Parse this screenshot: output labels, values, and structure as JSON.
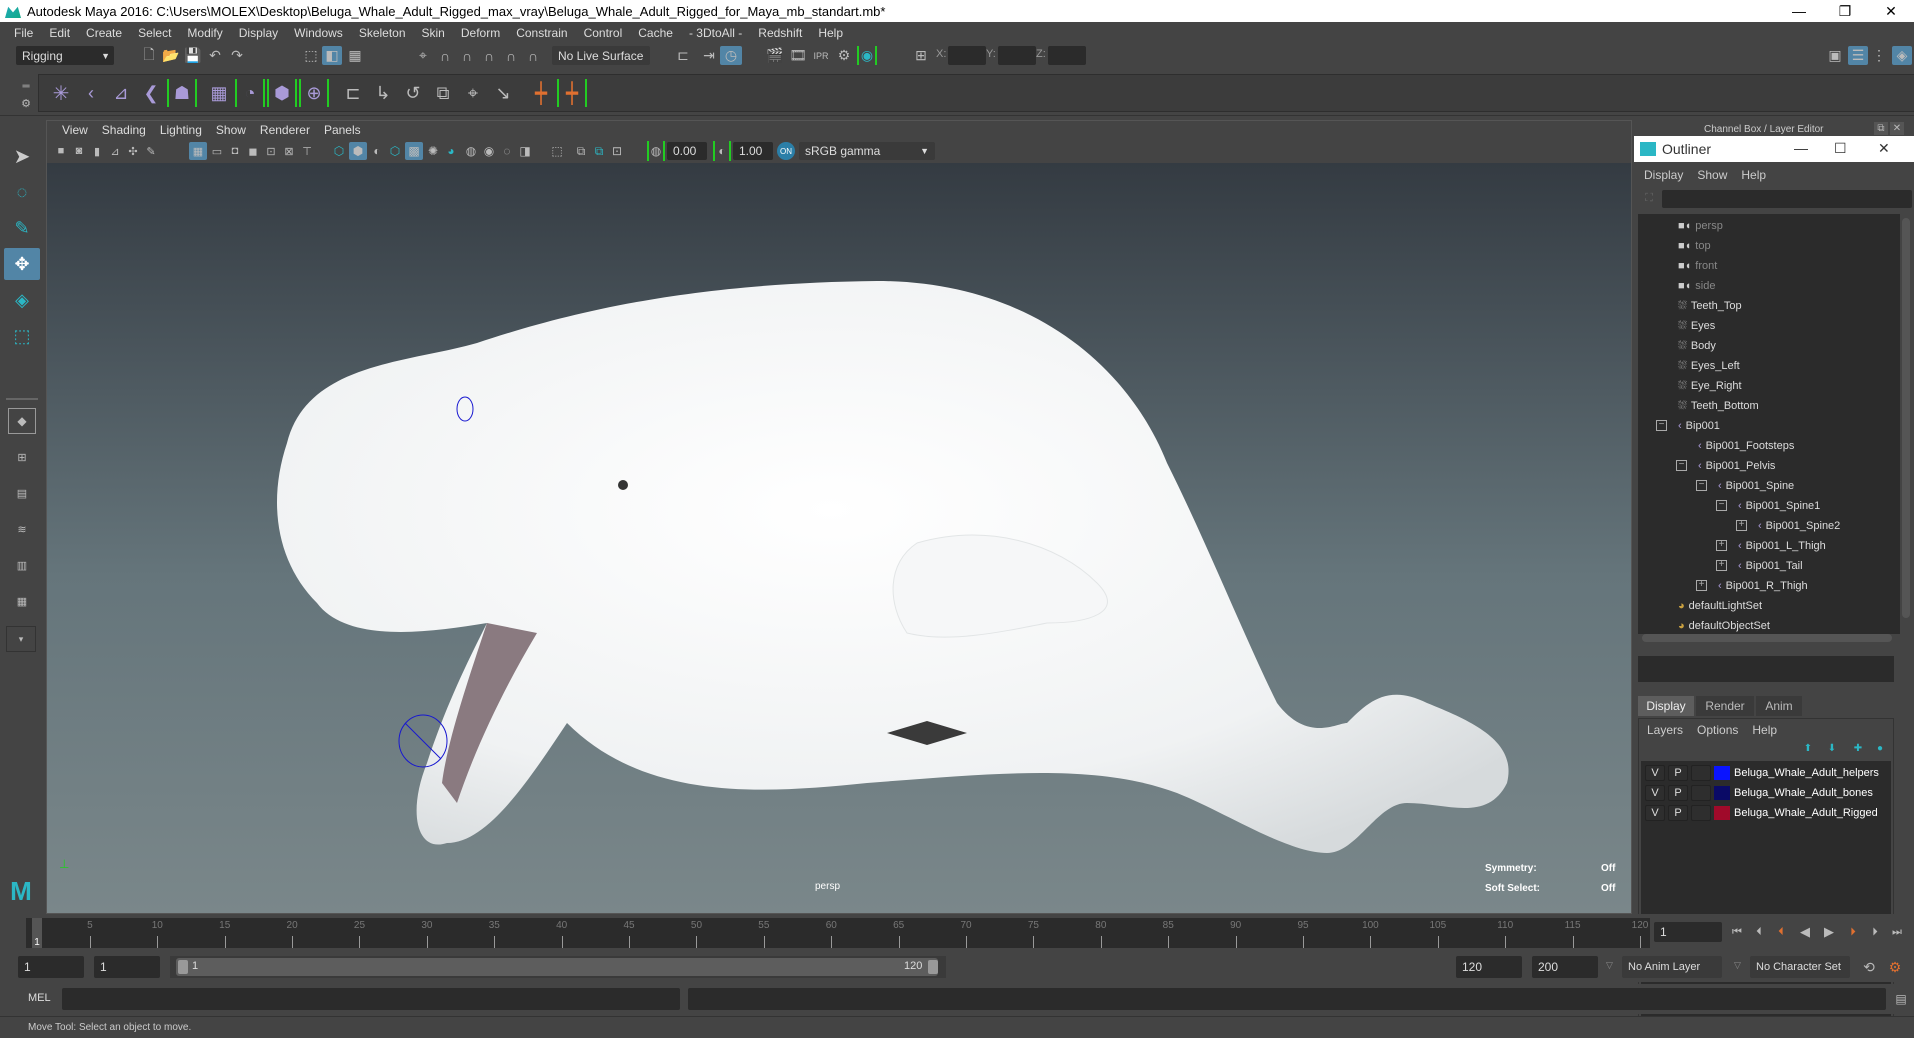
{
  "window": {
    "title": "Autodesk Maya 2016: C:\\Users\\MOLEX\\Desktop\\Beluga_Whale_Adult_Rigged_max_vray\\Beluga_Whale_Adult_Rigged_for_Maya_mb_standart.mb*",
    "minimize": "—",
    "restore": "❐",
    "close": "✕"
  },
  "menubar": [
    "File",
    "Edit",
    "Create",
    "Select",
    "Modify",
    "Display",
    "Windows",
    "Skeleton",
    "Skin",
    "Deform",
    "Constrain",
    "Control",
    "Cache",
    "- 3DtoAll -",
    "Redshift",
    "Help"
  ],
  "status_line": {
    "menu_set": "Rigging",
    "live_surface": "No Live Surface",
    "x_label": "X:",
    "y_label": "Y:",
    "z_label": "Z:",
    "x_value": "",
    "y_value": "",
    "z_value": ""
  },
  "viewport": {
    "menus": [
      "View",
      "Shading",
      "Lighting",
      "Show",
      "Renderer",
      "Panels"
    ],
    "exposure": "0.00",
    "gamma": "1.00",
    "color_space": "sRGB gamma",
    "camera_label": "persp",
    "hud": {
      "symmetry_label": "Symmetry:",
      "symmetry_value": "Off",
      "soft_select_label": "Soft Select:",
      "soft_select_value": "Off"
    }
  },
  "channel_box": {
    "title": "Channel Box / Layer Editor"
  },
  "outliner": {
    "title": "Outliner",
    "menus": [
      "Display",
      "Show",
      "Help"
    ],
    "filter_value": "",
    "items": [
      {
        "label": "persp",
        "type": "camera",
        "depth": 0
      },
      {
        "label": "top",
        "type": "camera",
        "depth": 0
      },
      {
        "label": "front",
        "type": "camera",
        "depth": 0
      },
      {
        "label": "side",
        "type": "camera",
        "depth": 0
      },
      {
        "label": "Teeth_Top",
        "type": "mesh",
        "depth": 0
      },
      {
        "label": "Eyes",
        "type": "mesh",
        "depth": 0
      },
      {
        "label": "Body",
        "type": "mesh",
        "depth": 0
      },
      {
        "label": "Eyes_Left",
        "type": "mesh",
        "depth": 0
      },
      {
        "label": "Eye_Right",
        "type": "mesh",
        "depth": 0
      },
      {
        "label": "Teeth_Bottom",
        "type": "mesh",
        "depth": 0
      },
      {
        "label": "Bip001",
        "type": "joint",
        "depth": 0,
        "expand": "minus"
      },
      {
        "label": "Bip001_Footsteps",
        "type": "joint",
        "depth": 1,
        "expand": "none"
      },
      {
        "label": "Bip001_Pelvis",
        "type": "joint",
        "depth": 1,
        "expand": "minus"
      },
      {
        "label": "Bip001_Spine",
        "type": "joint",
        "depth": 2,
        "expand": "minus"
      },
      {
        "label": "Bip001_Spine1",
        "type": "joint",
        "depth": 3,
        "expand": "minus"
      },
      {
        "label": "Bip001_Spine2",
        "type": "joint",
        "depth": 4,
        "expand": "plus"
      },
      {
        "label": "Bip001_L_Thigh",
        "type": "joint",
        "depth": 3,
        "expand": "plus"
      },
      {
        "label": "Bip001_Tail",
        "type": "joint",
        "depth": 3,
        "expand": "plus"
      },
      {
        "label": "Bip001_R_Thigh",
        "type": "joint",
        "depth": 2,
        "expand": "plus"
      },
      {
        "label": "defaultLightSet",
        "type": "set",
        "depth": 0
      },
      {
        "label": "defaultObjectSet",
        "type": "set",
        "depth": 0
      }
    ]
  },
  "layer_editor": {
    "tabs": [
      "Display",
      "Render",
      "Anim"
    ],
    "active_tab": "Display",
    "menus": [
      "Layers",
      "Options",
      "Help"
    ],
    "layers": [
      {
        "v": "V",
        "p": "P",
        "color": "#0a14ff",
        "name": "Beluga_Whale_Adult_helpers"
      },
      {
        "v": "V",
        "p": "P",
        "color": "#0a0a66",
        "name": "Beluga_Whale_Adult_bones"
      },
      {
        "v": "V",
        "p": "P",
        "color": "#a00a2a",
        "name": "Beluga_Whale_Adult_Rigged"
      }
    ]
  },
  "timeline": {
    "ticks": [
      5,
      10,
      15,
      20,
      25,
      30,
      35,
      40,
      45,
      50,
      55,
      60,
      65,
      70,
      75,
      80,
      85,
      90,
      95,
      100,
      105,
      110,
      115,
      120
    ],
    "current_frame_marker": "1",
    "current_frame": "1",
    "range_min": 1,
    "range_max": 120
  },
  "range_slider": {
    "start": "1",
    "playback_start": "1",
    "slider_start_label": "1",
    "slider_end_label": "120",
    "playback_end": "120",
    "end": "200",
    "anim_layer": "No Anim Layer",
    "character_set": "No Character Set"
  },
  "command_line": {
    "label": "MEL",
    "value": "",
    "result": ""
  },
  "help_line": "Move Tool: Select an object to move.",
  "colors": {
    "accent": "#5285a6",
    "teal": "#2bb7c5",
    "green_bracket": "#22cc22",
    "orange": "#e07030",
    "joint_purple": "#a99ad8"
  }
}
